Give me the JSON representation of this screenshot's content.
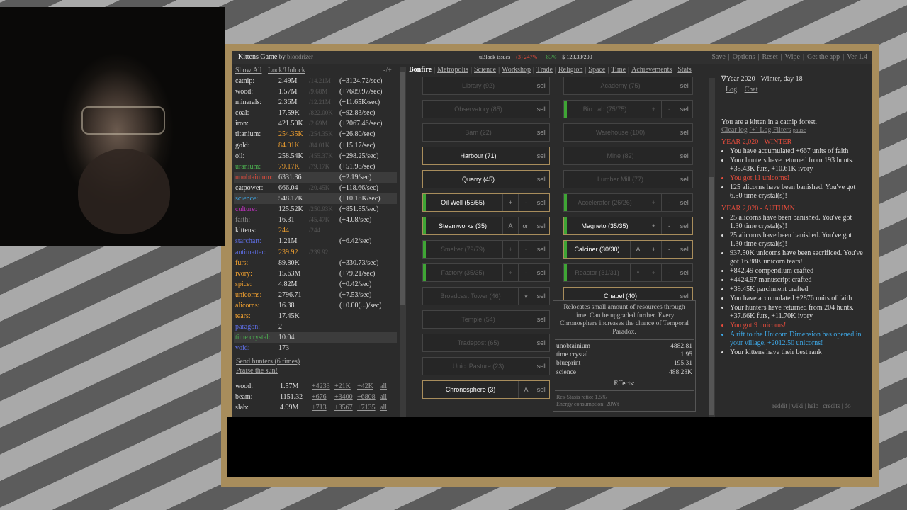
{
  "topbar": {
    "title": "Kittens Game",
    "by": "by",
    "author": "bloodrizer",
    "ublock": "uBlock issues",
    "ublock_red": "(3) 247%",
    "ublock_green": "+ 83%",
    "money": "$ 123.33/200",
    "links": [
      "Save",
      "Options",
      "Reset",
      "Wipe",
      "Get the app",
      "Ver 1.4"
    ]
  },
  "left": {
    "show_all": "Show All",
    "lock_unlock": "Lock/Unlock",
    "toggles": "-/+",
    "resources": [
      {
        "name": "catnip:",
        "amount": "2.49M",
        "max": "/14.21M",
        "rate": "(+3124.72/sec)",
        "color": "#dcdcdc"
      },
      {
        "name": "wood:",
        "amount": "1.57M",
        "max": "/9.68M",
        "rate": "(+7689.97/sec)",
        "color": "#dcdcdc"
      },
      {
        "name": "minerals:",
        "amount": "2.36M",
        "max": "/12.21M",
        "rate": "(+11.65K/sec)",
        "color": "#dcdcdc"
      },
      {
        "name": "coal:",
        "amount": "17.59K",
        "max": "/822.00K",
        "rate": "(+92.83/sec)",
        "color": "#dcdcdc"
      },
      {
        "name": "iron:",
        "amount": "421.50K",
        "max": "/2.69M",
        "rate": "(+2067.46/sec)",
        "color": "#dcdcdc"
      },
      {
        "name": "titanium:",
        "amount": "254.35K",
        "max": "/254.35K",
        "rate": "(+26.80/sec)",
        "color": "#dcdcdc",
        "amount_color": "#f0a030"
      },
      {
        "name": "gold:",
        "amount": "84.01K",
        "max": "/84.01K",
        "rate": "(+15.17/sec)",
        "color": "#dcdcdc",
        "amount_color": "#f0a030"
      },
      {
        "name": "oil:",
        "amount": "258.54K",
        "max": "/455.37K",
        "rate": "(+298.25/sec)",
        "color": "#dcdcdc"
      },
      {
        "name": "uranium:",
        "amount": "79.17K",
        "max": "/79.17K",
        "rate": "(+51.98/sec)",
        "color": "#4caf50",
        "amount_color": "#f0a030"
      },
      {
        "name": "unobtainium:",
        "amount": "6331.36",
        "max": "",
        "rate": "(+2.19/sec)",
        "color": "#e74c3c",
        "highlight": true
      },
      {
        "name": "catpower:",
        "amount": "666.04",
        "max": "/20.45K",
        "rate": "(+118.66/sec)",
        "color": "#dcdcdc"
      },
      {
        "name": "science:",
        "amount": "548.17K",
        "max": "",
        "rate": "(+10.18K/sec)",
        "color": "#3ea9e8",
        "highlight": true
      },
      {
        "name": "culture:",
        "amount": "125.52K",
        "max": "/250.93K",
        "rate": "(+851.85/sec)",
        "color": "#c030c0"
      },
      {
        "name": "faith:",
        "amount": "16.31",
        "max": "/45.47K",
        "rate": "(+4.08/sec)",
        "color": "#888"
      },
      {
        "name": "kittens:",
        "amount": "244",
        "max": "/244",
        "rate": "",
        "color": "#dcdcdc",
        "amount_color": "#f0a030"
      },
      {
        "name": "starchart:",
        "amount": "1.21M",
        "max": "",
        "rate": "(+6.42/sec)",
        "color": "#5f6fe8"
      },
      {
        "name": "antimatter:",
        "amount": "239.92",
        "max": "/239.92",
        "rate": "",
        "color": "#5f6fe8",
        "amount_color": "#f0a030"
      },
      {
        "name": "furs:",
        "amount": "89.80K",
        "max": "",
        "rate": "(+330.73/sec)",
        "color": "#f0a030"
      },
      {
        "name": "ivory:",
        "amount": "15.63M",
        "max": "",
        "rate": "(+79.21/sec)",
        "color": "#f0a030"
      },
      {
        "name": "spice:",
        "amount": "4.82M",
        "max": "",
        "rate": "(+0.42/sec)",
        "color": "#f0a030"
      },
      {
        "name": "unicorns:",
        "amount": "2796.71",
        "max": "",
        "rate": "(+7.53/sec)",
        "color": "#f0a030"
      },
      {
        "name": "alicorns:",
        "amount": "16.38",
        "max": "",
        "rate": "(+0.00(...)/sec)",
        "color": "#f0a030"
      },
      {
        "name": "tears:",
        "amount": "17.45K",
        "max": "",
        "rate": "",
        "color": "#f0a030"
      },
      {
        "name": "paragon:",
        "amount": "2",
        "max": "",
        "rate": "",
        "color": "#5f6fe8"
      },
      {
        "name": "time crystal:",
        "amount": "10.04",
        "max": "",
        "rate": "",
        "color": "#4caf50",
        "highlight": true
      },
      {
        "name": "void:",
        "amount": "173",
        "max": "",
        "rate": "",
        "color": "#5f6fe8"
      }
    ],
    "send_hunters": "Send hunters (6 times)",
    "praise": "Praise the sun!",
    "crafts": [
      {
        "name": "wood:",
        "amount": "1.57M",
        "c1": "+4233",
        "c2": "+21K",
        "c3": "+42K",
        "c4": "all"
      },
      {
        "name": "beam:",
        "amount": "1151.32",
        "c1": "+676",
        "c2": "+3400",
        "c3": "+6808",
        "c4": "all"
      },
      {
        "name": "slab:",
        "amount": "4.99M",
        "c1": "+713",
        "c2": "+3567",
        "c3": "+7135",
        "c4": "all"
      }
    ]
  },
  "tabs": [
    "Bonfire",
    "Metropolis",
    "Science",
    "Workshop",
    "Trade",
    "Religion",
    "Space",
    "Time",
    "Achievements",
    "Stats"
  ],
  "buildings": [
    {
      "label": "Library (92)",
      "on": false,
      "col": 0,
      "row": 0,
      "btns": [
        "sell"
      ]
    },
    {
      "label": "Academy (75)",
      "on": false,
      "col": 1,
      "row": 0,
      "btns": [
        "sell"
      ]
    },
    {
      "label": "Observatory (85)",
      "on": false,
      "col": 0,
      "row": 1,
      "btns": [
        "sell"
      ]
    },
    {
      "label": "Bio Lab (75/75)",
      "on": false,
      "col": 1,
      "row": 1,
      "green": true,
      "btns": [
        "+",
        "-",
        "sell"
      ]
    },
    {
      "label": "Barn (22)",
      "on": false,
      "col": 0,
      "row": 2,
      "btns": [
        "sell"
      ]
    },
    {
      "label": "Warehouse (100)",
      "on": false,
      "col": 1,
      "row": 2,
      "btns": [
        "sell"
      ]
    },
    {
      "label": "Harbour (71)",
      "on": true,
      "col": 0,
      "row": 3,
      "btns": [
        "sell"
      ]
    },
    {
      "label": "Mine (82)",
      "on": false,
      "col": 1,
      "row": 3,
      "btns": [
        "sell"
      ]
    },
    {
      "label": "Quarry (45)",
      "on": true,
      "col": 0,
      "row": 4,
      "btns": [
        "sell"
      ]
    },
    {
      "label": "Lumber Mill (77)",
      "on": false,
      "col": 1,
      "row": 4,
      "btns": [
        "sell"
      ]
    },
    {
      "label": "Oil Well (55/55)",
      "on": true,
      "col": 0,
      "row": 5,
      "green": true,
      "btns": [
        "+",
        "-",
        "sell"
      ]
    },
    {
      "label": "Accelerator (26/26)",
      "on": false,
      "col": 1,
      "row": 5,
      "green": true,
      "btns": [
        "+",
        "-",
        "sell"
      ]
    },
    {
      "label": "Steamworks (35)",
      "on": true,
      "col": 0,
      "row": 6,
      "green": true,
      "btns": [
        "A",
        "on",
        "sell"
      ]
    },
    {
      "label": "Magneto (35/35)",
      "on": true,
      "col": 1,
      "row": 6,
      "green": true,
      "btns": [
        "+",
        "-",
        "sell"
      ]
    },
    {
      "label": "Smelter (79/79)",
      "on": false,
      "col": 0,
      "row": 7,
      "green": true,
      "btns": [
        "+",
        "-",
        "sell"
      ]
    },
    {
      "label": "Calciner (30/30)",
      "on": true,
      "col": 1,
      "row": 7,
      "green": true,
      "btns": [
        "A",
        "+",
        "-",
        "sell"
      ]
    },
    {
      "label": "Factory (35/35)",
      "on": false,
      "col": 0,
      "row": 8,
      "green": true,
      "btns": [
        "+",
        "-",
        "sell"
      ]
    },
    {
      "label": "Reactor (31/31)",
      "on": false,
      "col": 1,
      "row": 8,
      "green": true,
      "btns": [
        "*",
        "+",
        "-",
        "sell"
      ]
    },
    {
      "label": "Broadcast Tower (46)",
      "on": false,
      "col": 0,
      "row": 9,
      "btns": [
        "v",
        "sell"
      ]
    },
    {
      "label": "Chapel (40)",
      "on": true,
      "col": 1,
      "row": 9,
      "btns": [
        "sell"
      ]
    },
    {
      "label": "Temple (54)",
      "on": false,
      "col": 0,
      "row": 10,
      "btns": [
        "sell"
      ]
    },
    {
      "label": "Tradepost (65)",
      "on": false,
      "col": 0,
      "row": 11,
      "btns": [
        "sell"
      ]
    },
    {
      "label": "Unic. Pasture (23)",
      "on": false,
      "col": 0,
      "row": 12,
      "btns": [
        "sell"
      ]
    },
    {
      "label": "Chronosphere (3)",
      "on": true,
      "col": 0,
      "row": 13,
      "btns": [
        "A",
        "sell"
      ]
    }
  ],
  "tooltip": {
    "desc": "Relocates small amount of resources through time. Can be upgraded further. Every Chronosphere increases the chance of Temporal Paradox.",
    "prices": [
      {
        "name": "unobtainium",
        "value": "4882.81"
      },
      {
        "name": "time crystal",
        "value": "1.95"
      },
      {
        "name": "blueprint",
        "value": "195.31"
      },
      {
        "name": "science",
        "value": "488.28K"
      }
    ],
    "effects_title": "Effects:",
    "effect1": "Res-Stasis ratio: 1.5%",
    "effect2": "Energy consumption: 20Wt"
  },
  "right": {
    "date": "∇Year 2020 - Winter, day 18",
    "log": "Log",
    "chat": "Chat",
    "intro": "You are a kitten in a catnip forest.",
    "clear_log": "Clear log",
    "log_filters": "[+] Log Filters",
    "pause": "pause",
    "seasons": [
      {
        "title": "YEAR 2,020 - WINTER",
        "entries": [
          {
            "text": "You have accumulated +667 units of faith",
            "cls": ""
          },
          {
            "text": "Your hunters have returned from 193 hunts. +35.43K furs, +10.61K ivory",
            "cls": ""
          },
          {
            "text": "You got 11 unicorns!",
            "cls": "red"
          },
          {
            "text": "125 alicorns have been banished. You've got 6.50 time crystal(s)!",
            "cls": ""
          }
        ]
      },
      {
        "title": "YEAR 2,020 - AUTUMN",
        "entries": [
          {
            "text": "25 alicorns have been banished. You've got 1.30 time crystal(s)!",
            "cls": ""
          },
          {
            "text": "25 alicorns have been banished. You've got 1.30 time crystal(s)!",
            "cls": ""
          },
          {
            "text": "937.50K unicorns have been sacrificed. You've got 16.88K unicorn tears!",
            "cls": ""
          },
          {
            "text": "+842.49 compendium crafted",
            "cls": ""
          },
          {
            "text": "+4424.97 manuscript crafted",
            "cls": ""
          },
          {
            "text": "+39.45K parchment crafted",
            "cls": ""
          },
          {
            "text": "You have accumulated +2876 units of faith",
            "cls": ""
          },
          {
            "text": "Your hunters have returned from 204 hunts. +37.66K furs, +11.70K ivory",
            "cls": ""
          },
          {
            "text": "You got 9 unicorns!",
            "cls": "red"
          },
          {
            "text": "A rift to the Unicorn Dimension has opened in your village, +2012.50 unicorns!",
            "cls": "blue"
          },
          {
            "text": "Your kittens have their best rank",
            "cls": ""
          }
        ]
      }
    ],
    "footer": "reddit | wiki | help | credits | do"
  }
}
